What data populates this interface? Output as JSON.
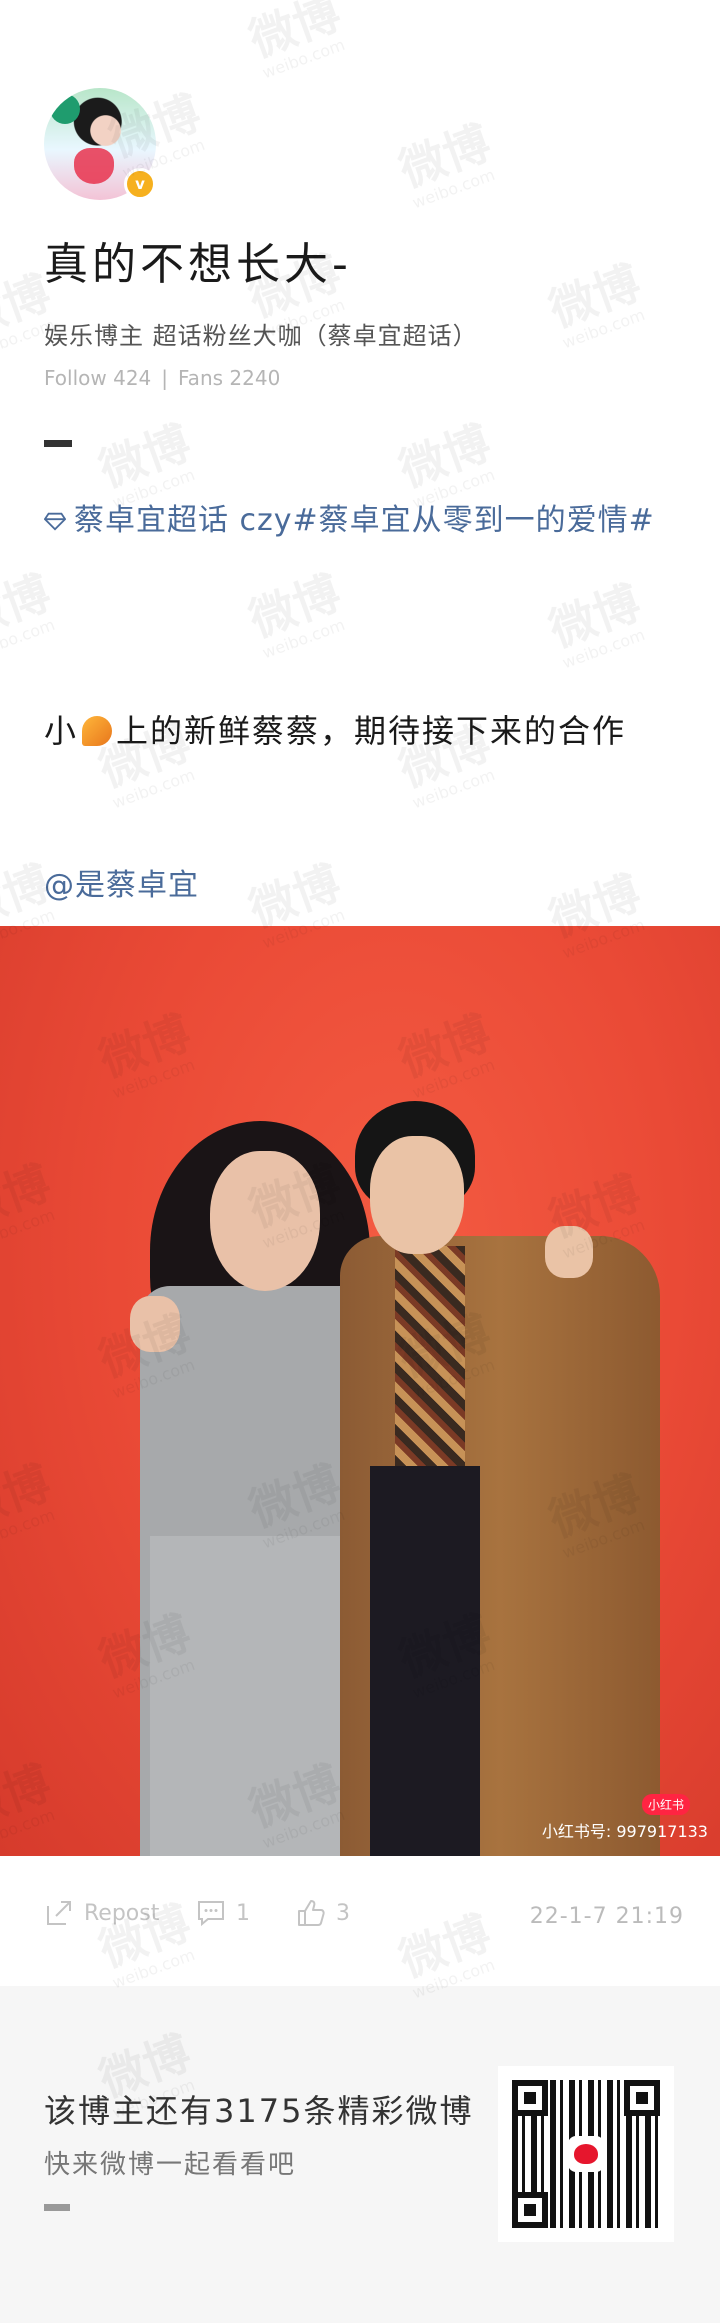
{
  "profile": {
    "name": "真的不想长大-",
    "description": "娱乐博主 超话粉丝大咖（蔡卓宜超话）",
    "follow_label": "Follow 424",
    "fans_label": "Fans 2240",
    "verified_mark": "v"
  },
  "post": {
    "topic_text": "蔡卓宜超话 czy#蔡卓宜从零到一的爱情#",
    "body_prefix": "小",
    "body_suffix": "上的新鲜蔡蔡，期待接下来的合作",
    "mention": "@是蔡卓宜",
    "photo_watermark_brand": "小红书",
    "photo_watermark_id": "小红书号: 997917133"
  },
  "actions": {
    "repost_label": "Repost",
    "comment_count": "1",
    "like_count": "3",
    "timestamp": "22-1-7 21:19"
  },
  "footer": {
    "main_text": "该博主还有3175条精彩微博",
    "sub_text": "快来微博一起看看吧"
  },
  "watermark": {
    "main": "微博",
    "sub": "weibo.com"
  },
  "icons": [
    "verified-icon",
    "diamond-icon",
    "flame-emoji-icon",
    "repost-icon",
    "comment-icon",
    "like-icon",
    "weibo-logo-icon"
  ],
  "colors": {
    "topic_link": "#4a6b9a",
    "photo_background": "#ea4a36",
    "verified_badge": "#f6b01e",
    "footer_background": "#f6f6f6"
  }
}
